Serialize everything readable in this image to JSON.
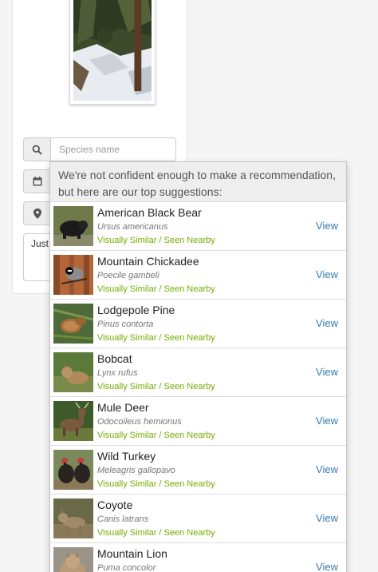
{
  "form": {
    "species_placeholder": "Species name",
    "notes_value": "Just"
  },
  "suggestions": {
    "header": "We're not confident enough to make a recommendation, but here are our top suggestions:",
    "items": [
      {
        "common": "American Black Bear",
        "scientific": "Ursus americanus",
        "basis": "Visually Similar / Seen Nearby",
        "action": "View"
      },
      {
        "common": "Mountain Chickadee",
        "scientific": "Poecile gambeli",
        "basis": "Visually Similar / Seen Nearby",
        "action": "View"
      },
      {
        "common": "Lodgepole Pine",
        "scientific": "Pinus contorta",
        "basis": "Visually Similar / Seen Nearby",
        "action": "View"
      },
      {
        "common": "Bobcat",
        "scientific": "Lynx rufus",
        "basis": "Visually Similar / Seen Nearby",
        "action": "View"
      },
      {
        "common": "Mule Deer",
        "scientific": "Odocoileus hemionus",
        "basis": "Visually Similar / Seen Nearby",
        "action": "View"
      },
      {
        "common": "Wild Turkey",
        "scientific": "Meleagris gallopavo",
        "basis": "Visually Similar / Seen Nearby",
        "action": "View"
      },
      {
        "common": "Coyote",
        "scientific": "Canis latrans",
        "basis": "Visually Similar / Seen Nearby",
        "action": "View"
      },
      {
        "common": "Mountain Lion",
        "scientific": "Puma concolor",
        "basis": "",
        "action": "View"
      }
    ]
  },
  "colors": {
    "basis_green": "#74ac00",
    "link_blue": "#337ab7"
  }
}
